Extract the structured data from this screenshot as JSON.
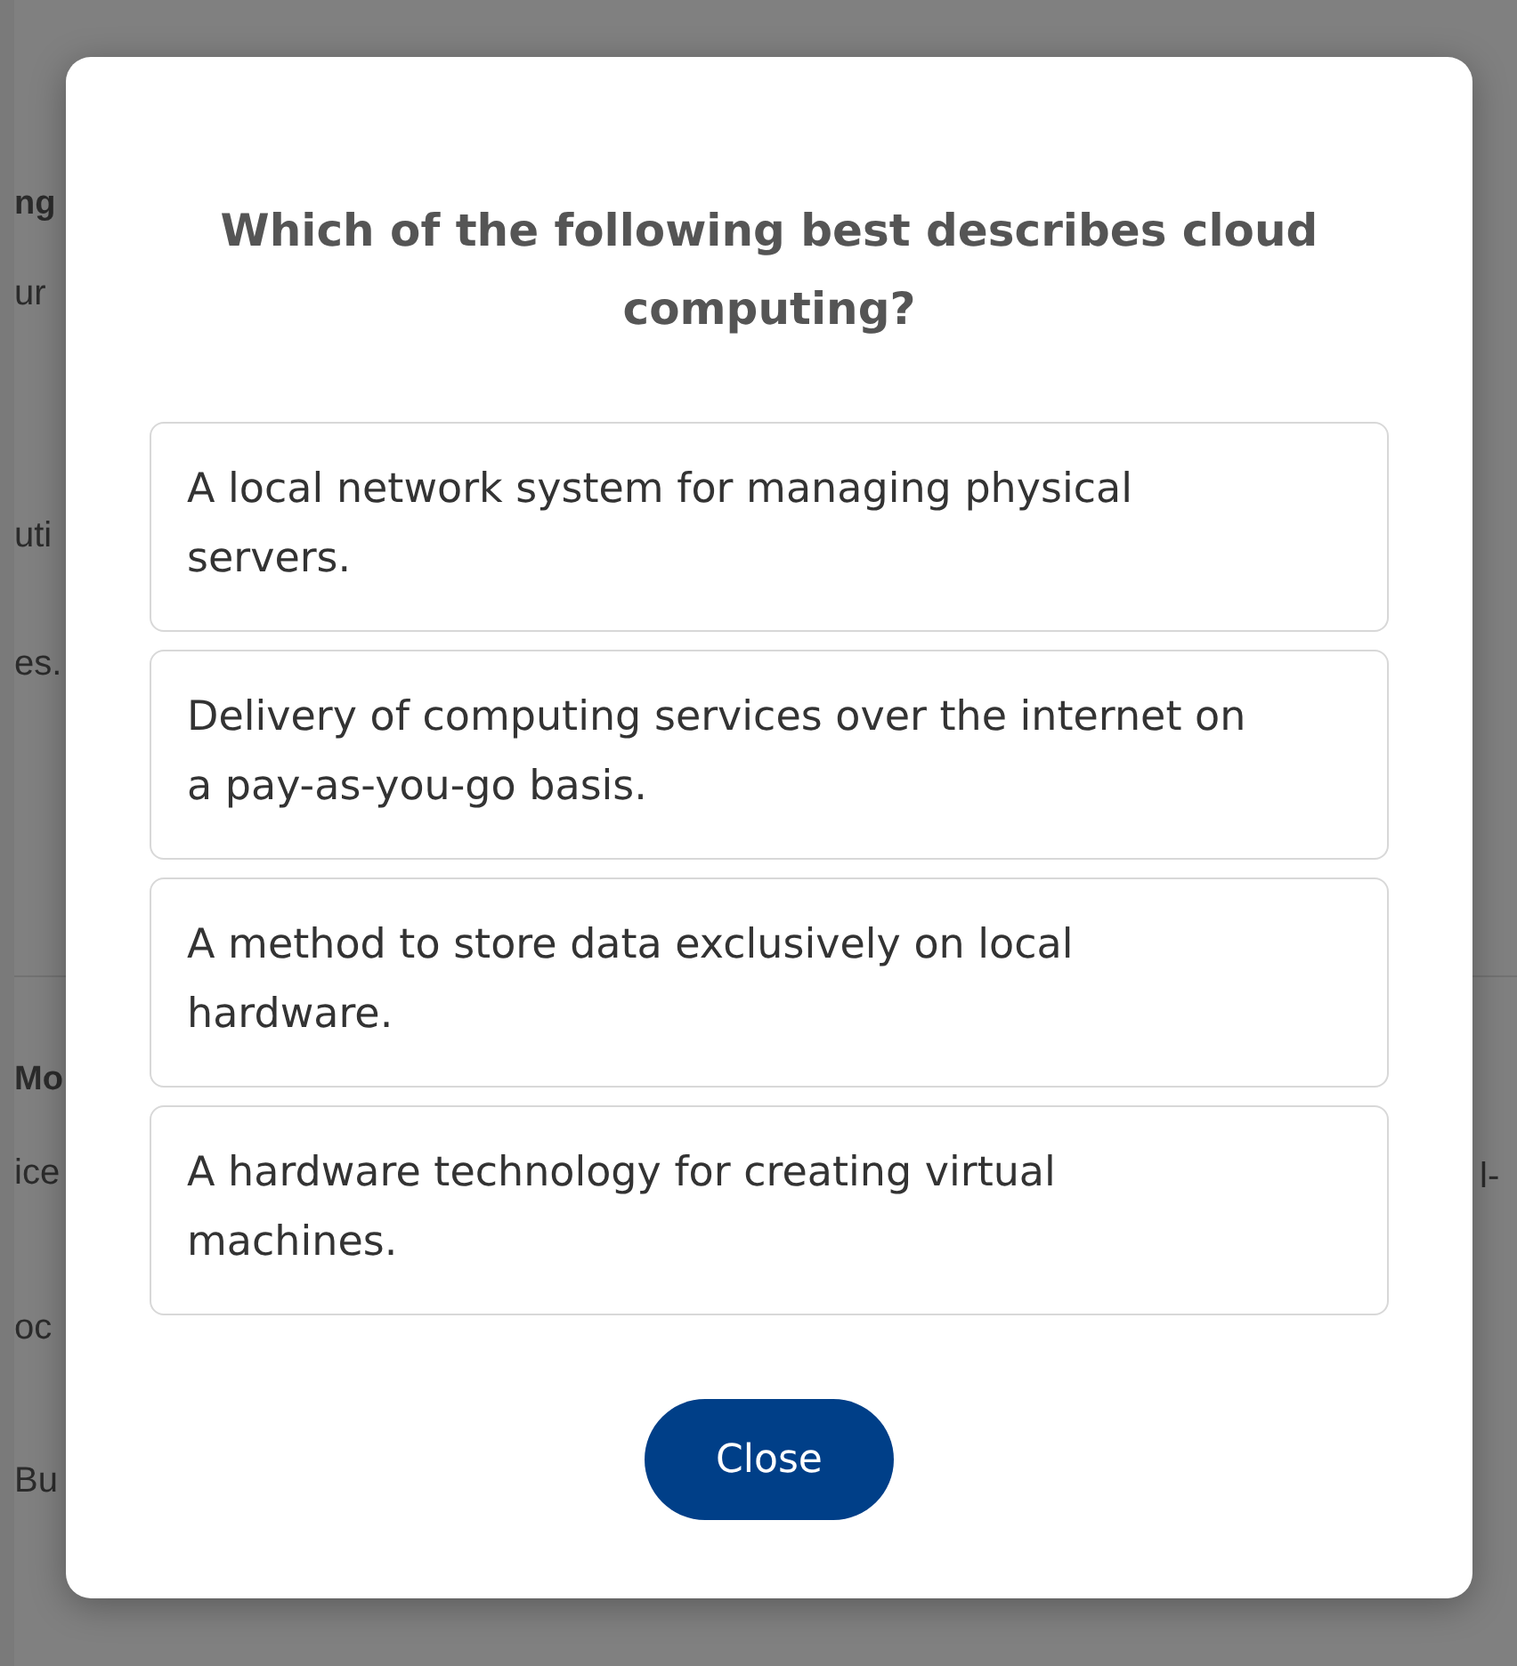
{
  "background": {
    "left_fragments": [
      {
        "text": "ng",
        "kind": "heading"
      },
      {
        "text": "ur",
        "kind": "text"
      },
      {
        "text": "uti",
        "kind": "text"
      },
      {
        "text": "es.",
        "kind": "text"
      },
      {
        "text": "Mo",
        "kind": "heading"
      },
      {
        "text": "ice",
        "kind": "text"
      },
      {
        "text": "oc",
        "kind": "text"
      },
      {
        "text": "Bu",
        "kind": "text"
      }
    ],
    "right_fragments": [
      "l-"
    ]
  },
  "dialog": {
    "question": "Which of the following best describes cloud computing?",
    "options": [
      {
        "label": "A local network system for managing physical servers.",
        "selected": false
      },
      {
        "label": "Delivery of computing services over the internet on a pay-as-you-go basis.",
        "selected": false
      },
      {
        "label": "A method to store data exclusively on local hardware.",
        "selected": false
      },
      {
        "label": "A hardware technology for creating virtual machines.",
        "selected": false
      }
    ],
    "close_button": "Close"
  }
}
